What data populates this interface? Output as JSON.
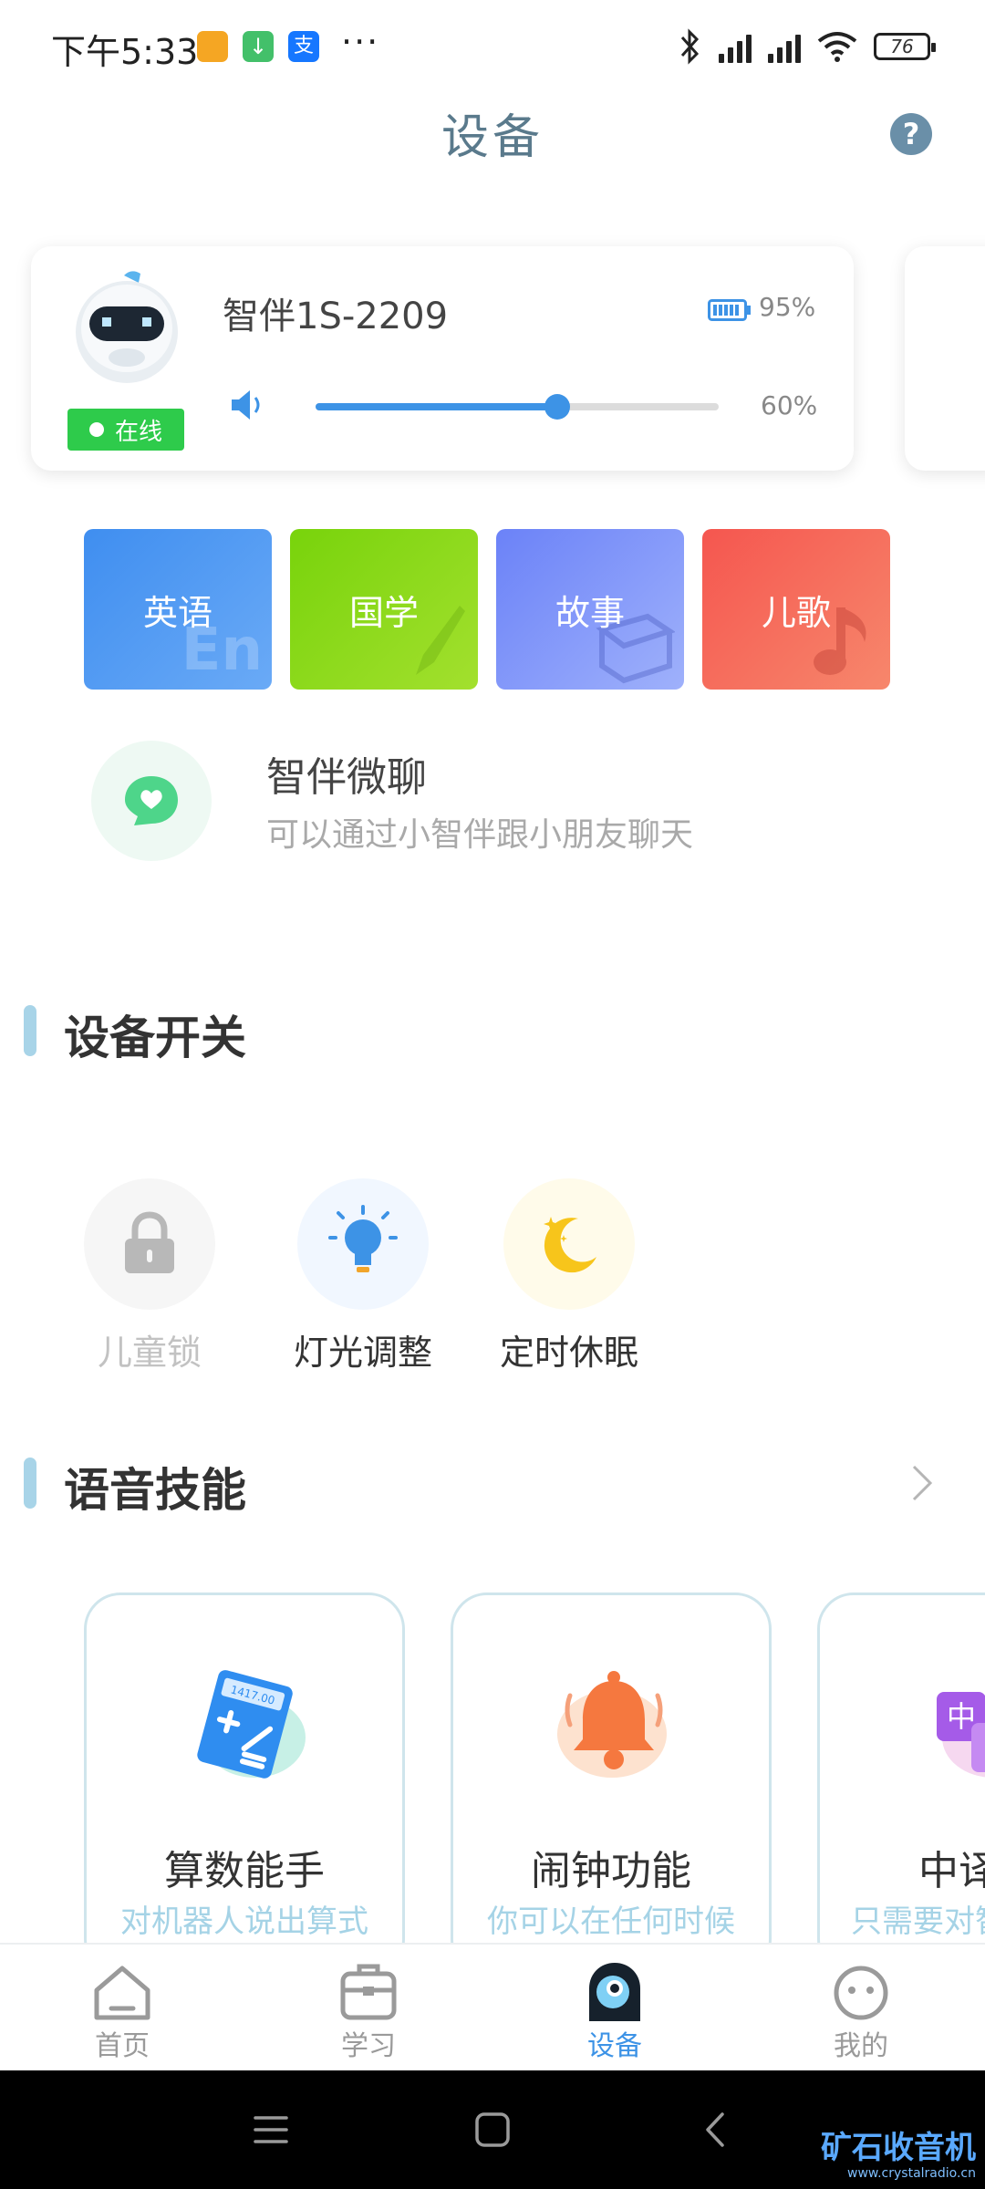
{
  "status_bar": {
    "time": "下午5:33",
    "battery": "76",
    "icons": [
      "app-notification-icon",
      "download-icon",
      "alipay-icon",
      "bluetooth-icon",
      "signal-icon",
      "hd-signal-icon",
      "wifi-icon",
      "battery-icon"
    ]
  },
  "header": {
    "title": "设备",
    "help": "?"
  },
  "device": {
    "name": "智伴1S-2209",
    "status": "在线",
    "battery_percent": "95%",
    "volume_percent": "60%",
    "volume_level": 0.6
  },
  "categories": [
    {
      "label": "英语",
      "deco": "En",
      "color_from": "#3f8ef0",
      "color_to": "#6aaaf6"
    },
    {
      "label": "国学",
      "deco": "brush",
      "color_from": "#78d30b",
      "color_to": "#a3e02e"
    },
    {
      "label": "故事",
      "deco": "book",
      "color_from": "#6b82f8",
      "color_to": "#9fb1fb"
    },
    {
      "label": "儿歌",
      "deco": "music",
      "color_from": "#f5564f",
      "color_to": "#f7876c"
    }
  ],
  "chat": {
    "title": "智伴微聊",
    "subtitle": "可以通过小智伴跟小朋友聊天"
  },
  "switches_section": {
    "title": "设备开关",
    "items": [
      {
        "label": "儿童锁",
        "icon": "lock-icon",
        "enabled": false
      },
      {
        "label": "灯光调整",
        "icon": "lightbulb-icon",
        "enabled": true
      },
      {
        "label": "定时休眠",
        "icon": "moon-icon",
        "enabled": true
      }
    ]
  },
  "skills_section": {
    "title": "语音技能",
    "items": [
      {
        "title": "算数能手",
        "subtitle": "对机器人说出算式",
        "icon_text": "1417.00"
      },
      {
        "title": "闹钟功能",
        "subtitle": "你可以在任何时候"
      },
      {
        "title": "中译",
        "subtitle": "只需要对智",
        "icon_text": "中"
      }
    ]
  },
  "tabbar": {
    "tabs": [
      {
        "label": "首页",
        "active": false
      },
      {
        "label": "学习",
        "active": false
      },
      {
        "label": "设备",
        "active": true
      },
      {
        "label": "我的",
        "active": false
      }
    ]
  },
  "watermark": {
    "text": "矿石收音机",
    "url": "www.crystalradio.cn"
  }
}
